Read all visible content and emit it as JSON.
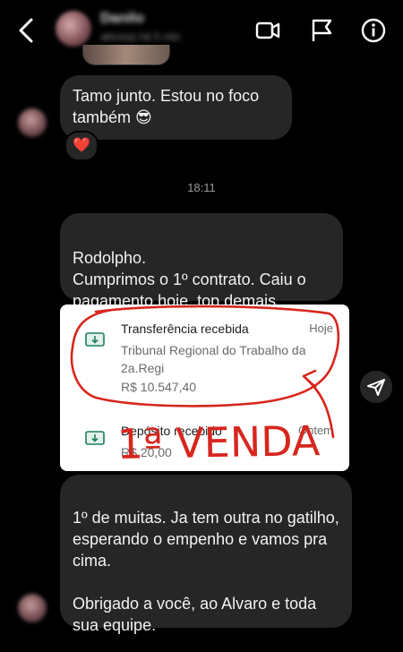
{
  "header": {
    "contact_name": "Danilo",
    "contact_status": "ativo(a) há 5 min",
    "icons": [
      "back-chevron-icon",
      "video-call-icon",
      "flag-icon",
      "info-icon"
    ]
  },
  "messages": [
    {
      "from": "contact",
      "text": "Tamo junto. Estou no foco também 😎",
      "reaction": "❤️"
    },
    {
      "type": "timestamp",
      "text": "18:11"
    },
    {
      "from": "contact",
      "text": "Rodolpho.\nCumprimos o 1º contrato. Caiu o pagamento hoje, top demais."
    },
    {
      "from": "contact",
      "type": "image",
      "receipt": {
        "items": [
          {
            "title": "Transferência recebida",
            "date": "Hoje",
            "detail": "Tribunal Regional do Trabalho da 2a.Regi",
            "amount": "R$ 10.547,40"
          },
          {
            "title": "Depósito recebido",
            "date": "Ontem",
            "amount": "R$ 20,00"
          }
        ],
        "handwritten": "1ª VENDA",
        "annotation_color": "#d7261e"
      }
    },
    {
      "from": "contact",
      "text": "1º de muitas. Ja tem outra no gatilho, esperando o empenho e vamos pra cima.\n\nObrigado a você, ao Alvaro e toda sua equipe."
    }
  ],
  "colors": {
    "background": "#000000",
    "bubble": "#262626",
    "text": "#f2f2f2",
    "timestamp": "#9a9a9a"
  }
}
